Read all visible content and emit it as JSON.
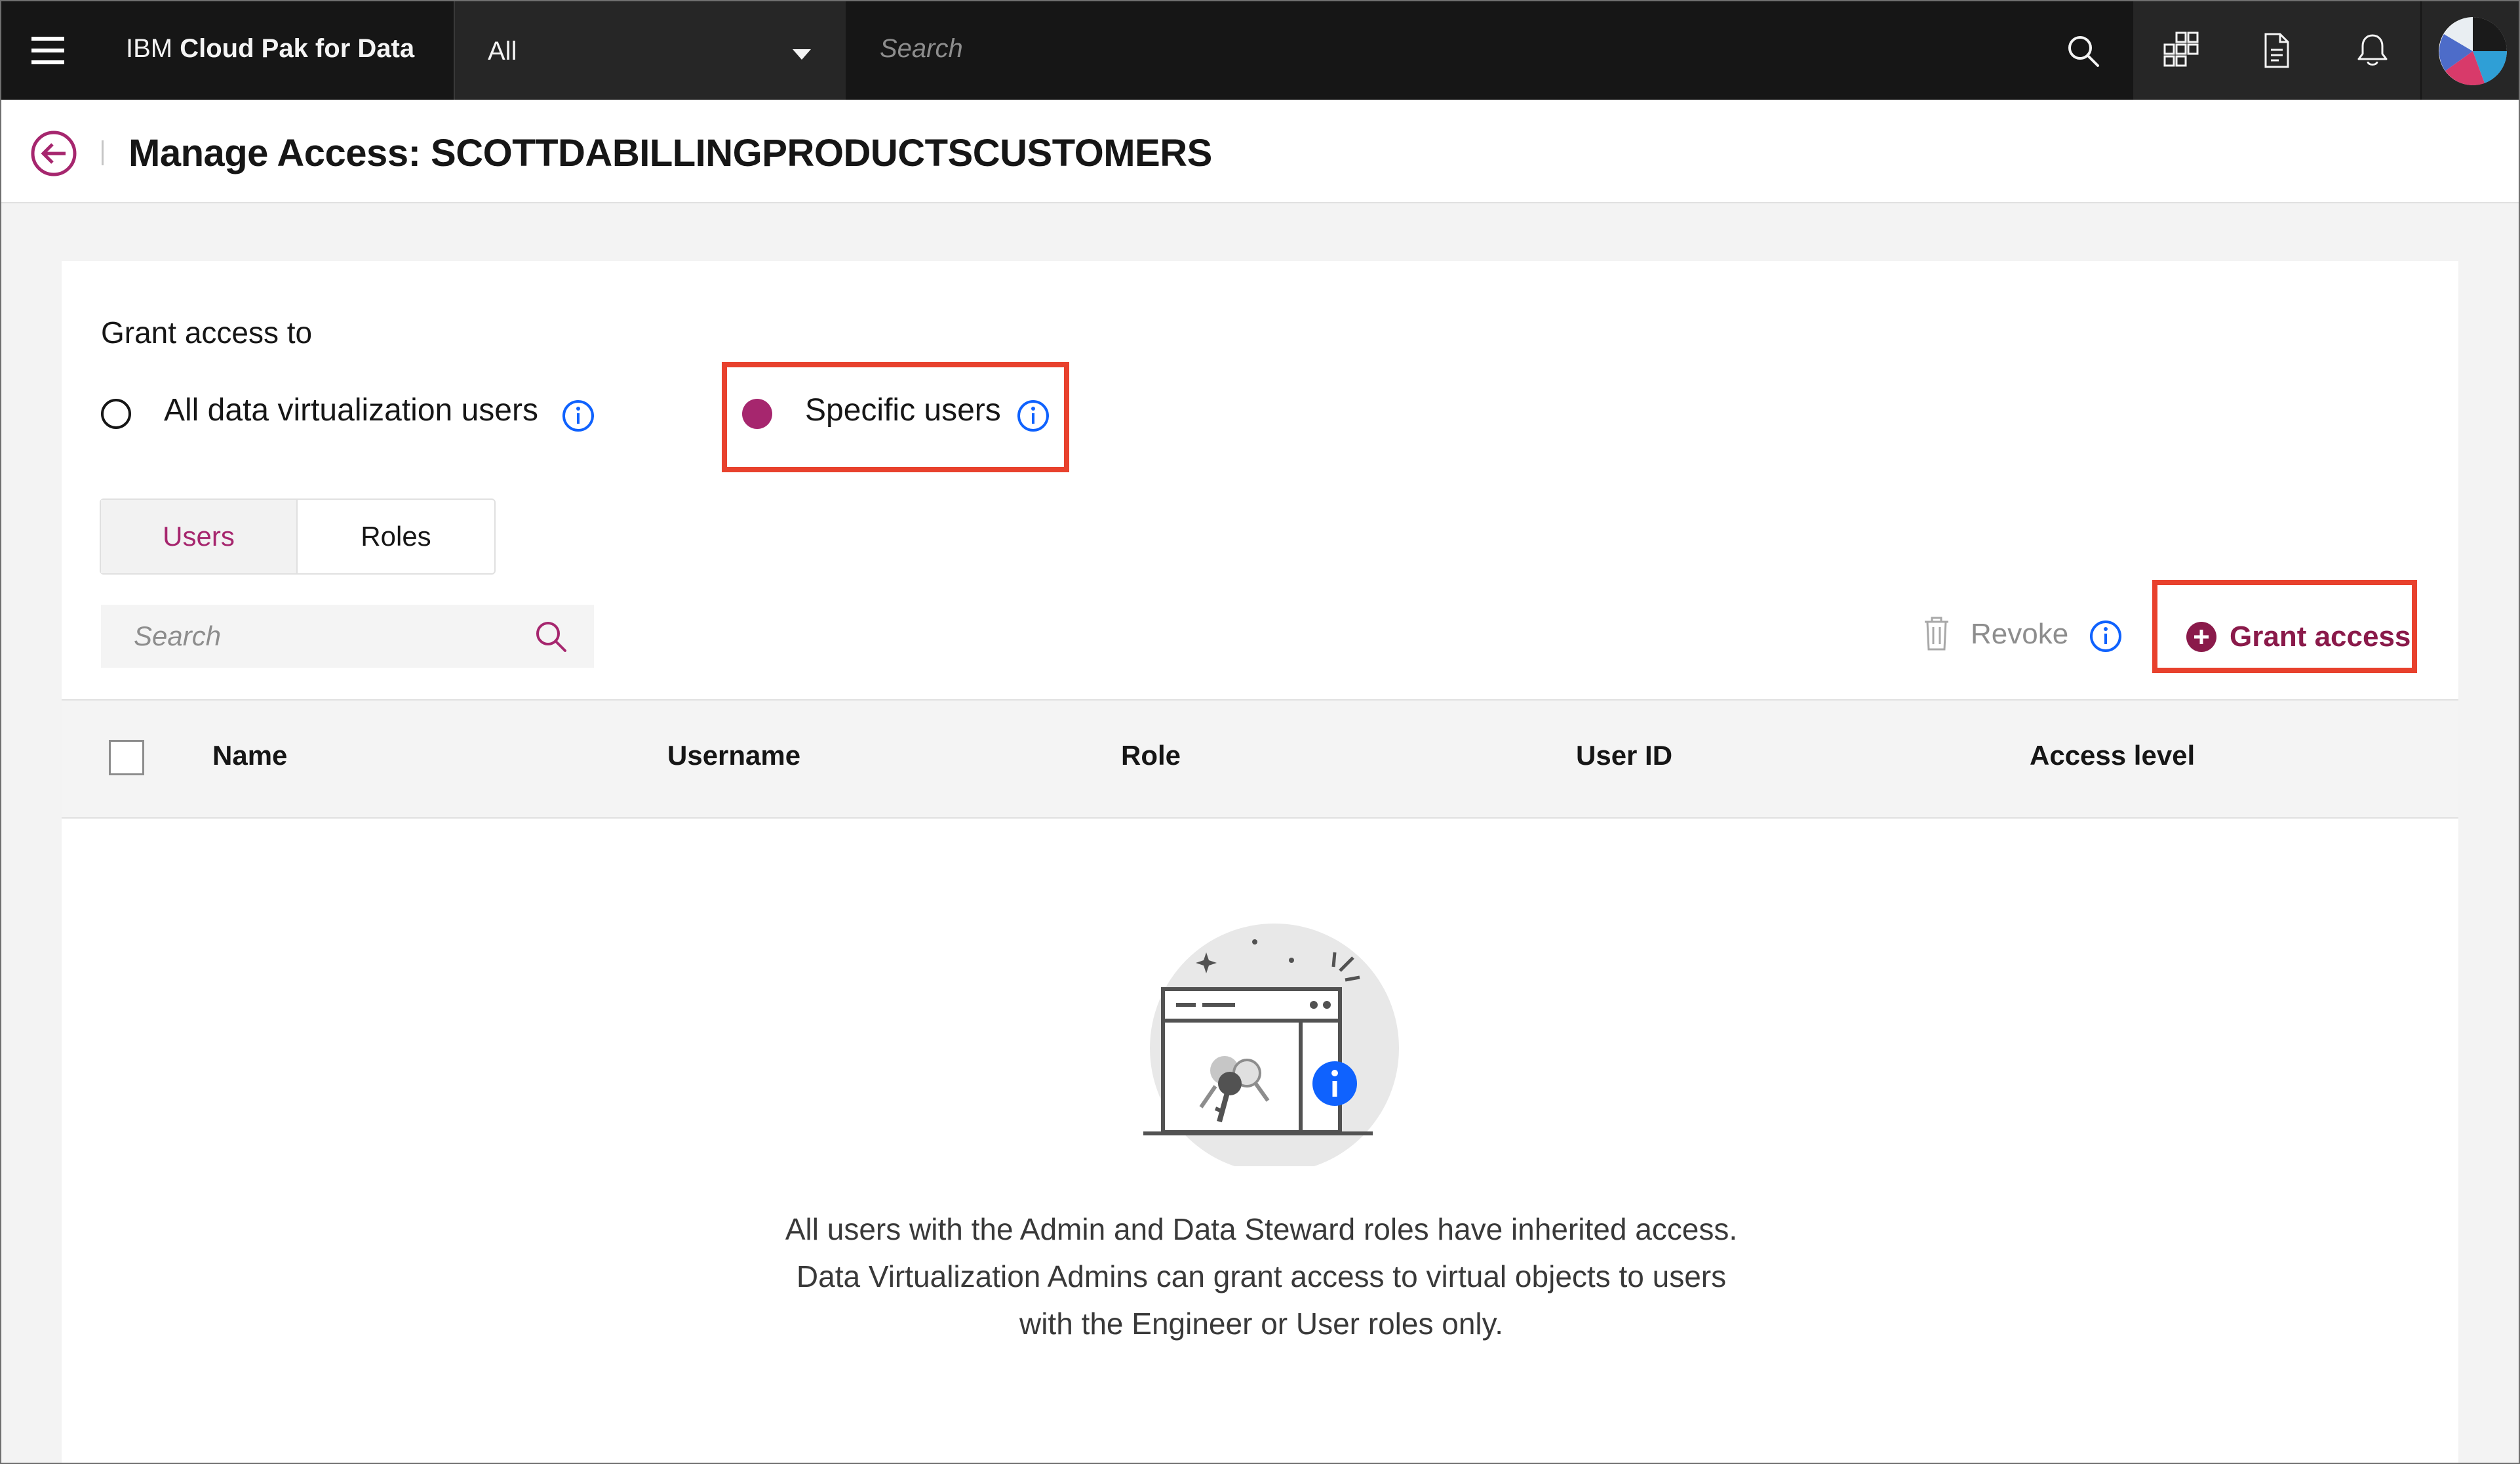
{
  "topbar": {
    "brand_prefix": "IBM ",
    "brand_name": "Cloud Pak for Data",
    "scope_selected": "All",
    "search_placeholder": "Search",
    "icons": [
      "menu-icon",
      "search-icon",
      "apps-icon",
      "document-icon",
      "notification-icon",
      "user-avatar"
    ]
  },
  "header": {
    "title": "Manage Access: SCOTTDABILLINGPRODUCTSCUSTOMERS"
  },
  "grant": {
    "label": "Grant access to",
    "options": [
      {
        "label": "All data virtualization users",
        "selected": false
      },
      {
        "label": "Specific users",
        "selected": true
      }
    ]
  },
  "tabs": {
    "users": "Users",
    "roles": "Roles",
    "selected": "Users"
  },
  "table": {
    "search_placeholder": "Search",
    "revoke_label": "Revoke",
    "grant_label": "Grant access",
    "columns": [
      "Name",
      "Username",
      "Role",
      "User ID",
      "Access level"
    ],
    "rows": []
  },
  "empty_state": {
    "message": "All users with the Admin and Data Steward roles have inherited access. Data Virtualization Admins can grant access to virtual objects to users with the Engineer or User roles only."
  },
  "colors": {
    "accent": "#a6266e",
    "grant_text": "#8a1a4a",
    "highlight": "#e8412d",
    "info_blue": "#0f62fe",
    "topbar": "#161616"
  }
}
